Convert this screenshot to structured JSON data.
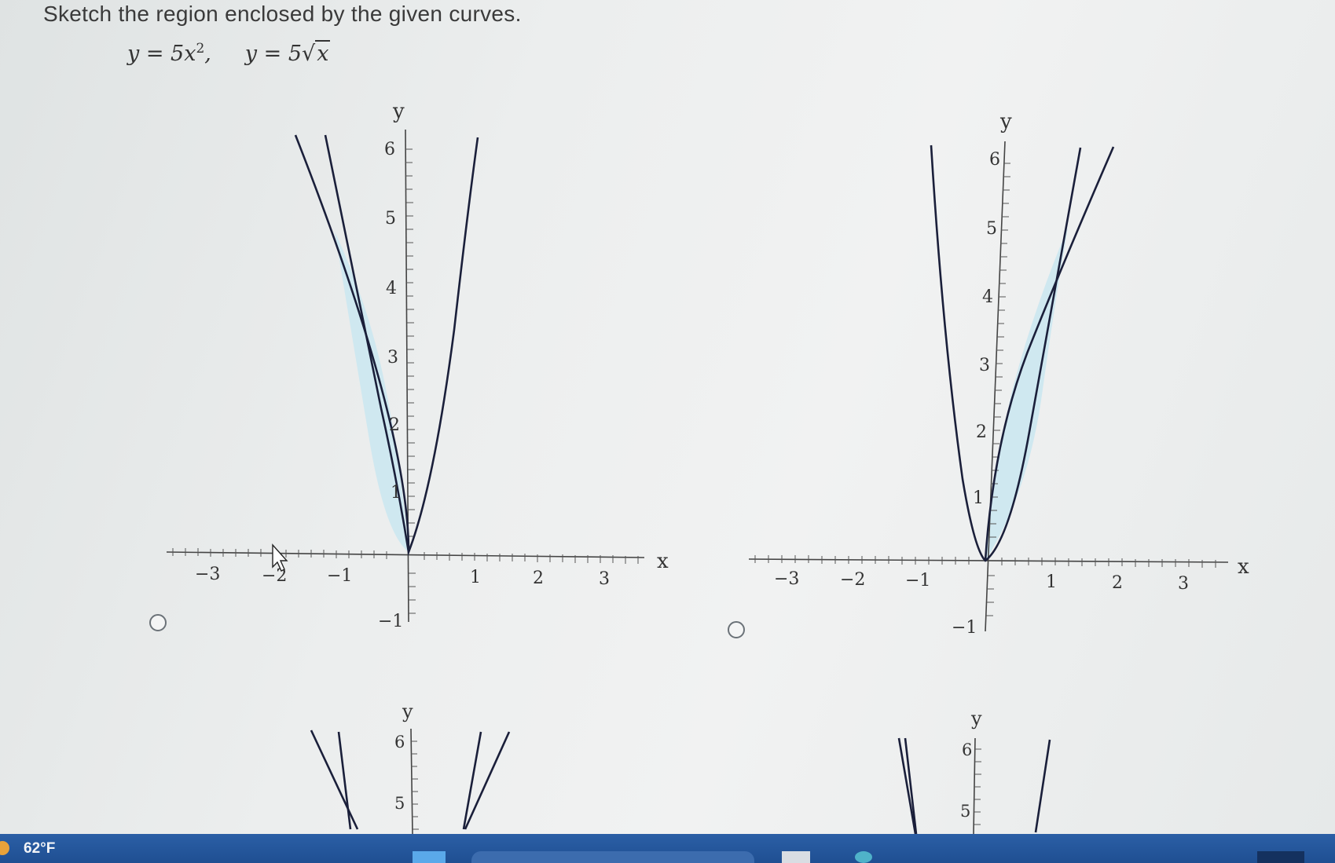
{
  "question": {
    "prompt": "Sketch the region enclosed by the given curves.",
    "eq1_lhs": "y = 5x",
    "eq1_exp": "2",
    "eq1_comma": ",",
    "eq2_lhs": "y = 5",
    "eq2_radicand": "x"
  },
  "graphs": [
    {
      "axis_x_label": "x",
      "axis_y_label": "y",
      "x_ticks": [
        "−3",
        "−2",
        "−1",
        "1",
        "2",
        "3"
      ],
      "y_ticks": [
        "6",
        "5",
        "4",
        "3",
        "2",
        "1",
        "−1"
      ],
      "option_selected": false
    },
    {
      "axis_x_label": "x",
      "axis_y_label": "y",
      "x_ticks": [
        "−3",
        "−2",
        "−1",
        "1",
        "2",
        "3"
      ],
      "y_ticks": [
        "6",
        "5",
        "4",
        "3",
        "2",
        "1",
        "−1"
      ],
      "option_selected": false
    },
    {
      "axis_y_label": "y",
      "y_ticks": [
        "6",
        "5"
      ]
    },
    {
      "axis_y_label": "y",
      "y_ticks": [
        "6",
        "5"
      ]
    }
  ],
  "colors": {
    "shaded_region": "#cfe8f0",
    "curve": "#1a1f3a",
    "taskbar": "#2558a0"
  },
  "taskbar": {
    "temperature": "62°F",
    "weather_icon": "sun-icon"
  }
}
